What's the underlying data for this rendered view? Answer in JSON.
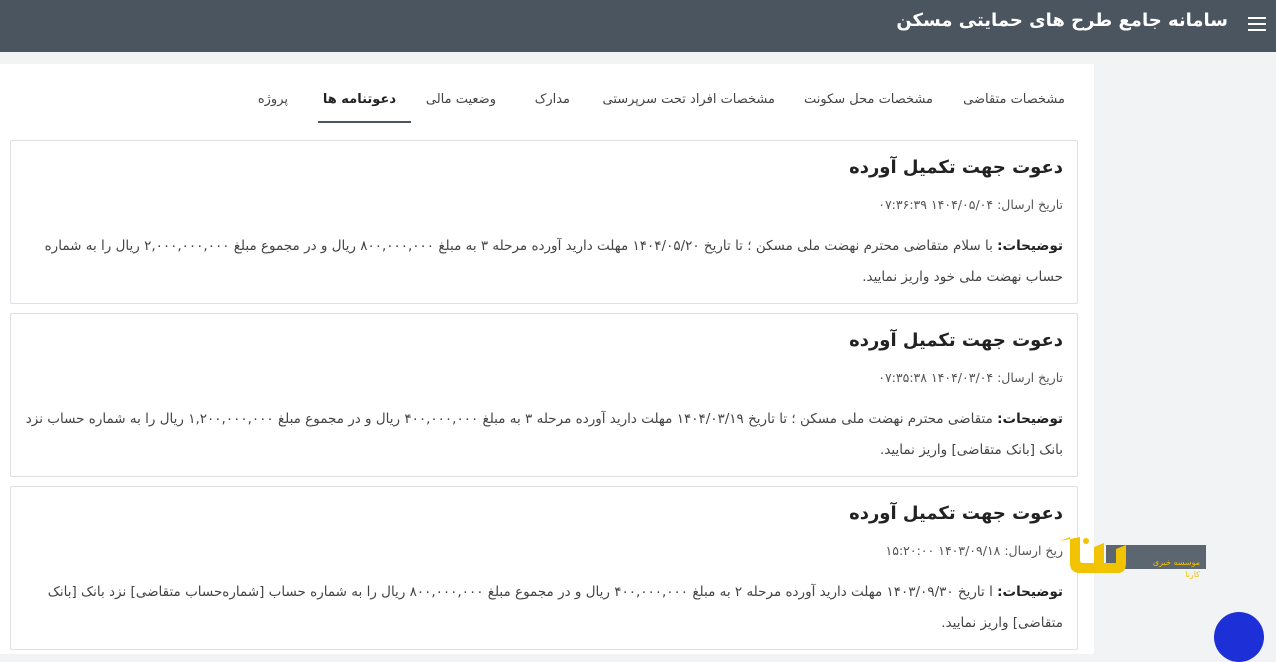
{
  "header": {
    "title": "سامانه جامع طرح های حمایتی مسکن"
  },
  "tabs": [
    {
      "label": "مشخصات متقاضی"
    },
    {
      "label": "مشخصات محل سکونت"
    },
    {
      "label": "مشخصات افراد تحت سرپرستی"
    },
    {
      "label": "مدارک"
    },
    {
      "label": "وضعیت مالی"
    },
    {
      "label": "دعوتنامه ها",
      "active": true
    },
    {
      "label": "پروژه"
    }
  ],
  "cards": [
    {
      "title": "دعوت جهت تکمیل آورده",
      "date": "تاریخ ارسال: ۱۴۰۴/۰۵/۰۴ ۰۷:۳۶:۳۹",
      "desc_label": "توضیحات:",
      "desc_text": " با سلام متقاضی محترم نهضت ملی مسکن ؛ تا تاریخ ۱۴۰۴/۰۵/۲۰ مهلت دارید آورده مرحله ۳ به مبلغ ۸۰۰,۰۰۰,۰۰۰ ریال و در مجموع مبلغ ۲,۰۰۰,۰۰۰,۰۰۰ ریال را به شماره حساب نهضت ملی خود واریز نمایید."
    },
    {
      "title": "دعوت جهت تکمیل آورده",
      "date": "تاریخ ارسال: ۱۴۰۴/۰۳/۰۴ ۰۷:۳۵:۳۸",
      "desc_label": "توضیحات:",
      "desc_text": " متقاضی محترم نهضت ملی مسکن ؛ تا تاریخ ۱۴۰۴/۰۳/۱۹ مهلت دارید آورده مرحله ۳ به مبلغ ۴۰۰,۰۰۰,۰۰۰ ریال و در مجموع مبلغ ۱,۲۰۰,۰۰۰,۰۰۰ ریال را به شماره حساب نزد بانک [بانک متقاضی] واریز نمایید."
    },
    {
      "title": "دعوت جهت تکمیل آورده",
      "date": "ریخ ارسال: ۱۴۰۳/۰۹/۱۸ ۱۵:۲۰:۰۰",
      "desc_label": "توضیحات:",
      "desc_text": " ا تاریخ ۱۴۰۳/۰۹/۳۰ مهلت دارید آورده مرحله ۲ به مبلغ ۴۰۰,۰۰۰,۰۰۰ ریال و در مجموع مبلغ ۸۰۰,۰۰۰,۰۰۰ ریال را به شماره حساب [شماره‌حساب متقاضی] نزد بانک [بانک متقاضی] واریز نمایید."
    }
  ],
  "watermark": {
    "line1": "موسسه خبری",
    "line2": "کارنا"
  },
  "colors": {
    "header_bg": "#4a5560",
    "accent_yellow": "#f2c300",
    "fab_blue": "#1d2fd6"
  }
}
